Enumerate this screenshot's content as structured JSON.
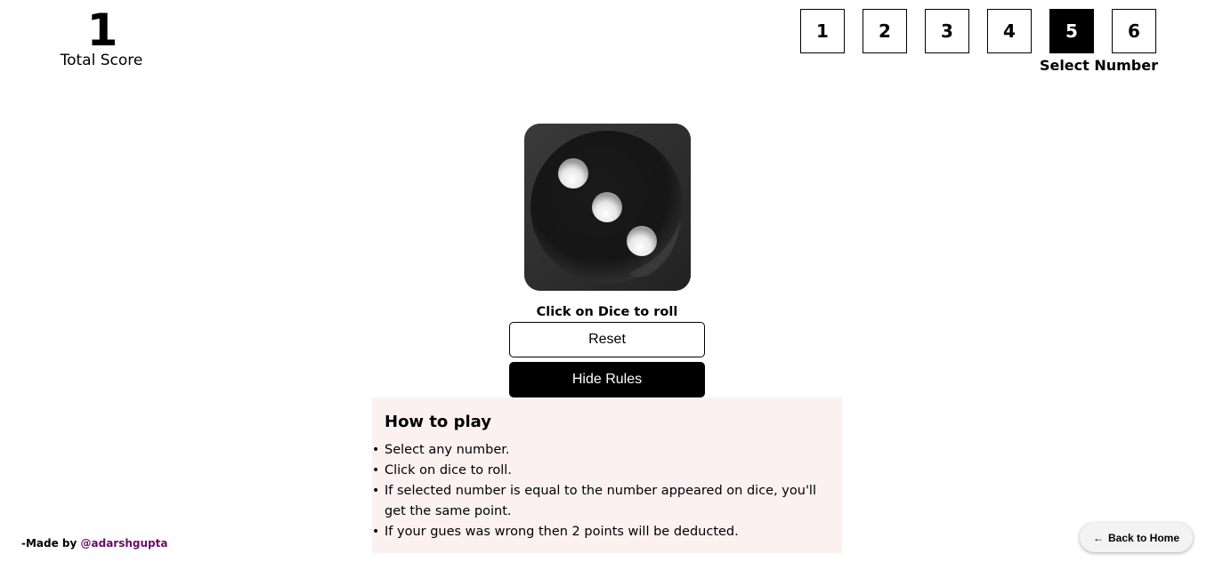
{
  "score": {
    "value": "1",
    "label": "Total Score"
  },
  "number_selector": {
    "options": [
      "1",
      "2",
      "3",
      "4",
      "5",
      "6"
    ],
    "selected": "5",
    "label": "Select Number"
  },
  "dice": {
    "face_value": 3,
    "hint": "Click on Dice to roll"
  },
  "buttons": {
    "reset": "Reset",
    "hide_rules": "Hide Rules"
  },
  "rules": {
    "title": "How to play",
    "items": [
      "Select any number.",
      "Click on dice to roll.",
      "If selected number is equal to the number appeared on dice, you'll get the same point.",
      "If your gues was wrong then 2 points will be deducted."
    ]
  },
  "footer": {
    "made_by_prefix": "-Made by ",
    "handle": "@adarshgupta",
    "back_home": "Back to Home",
    "back_icon": "arrow-left-icon"
  },
  "colors": {
    "selected_bg": "#000000",
    "rules_bg": "#fbf1f1",
    "handle": "#6b0a6b"
  }
}
